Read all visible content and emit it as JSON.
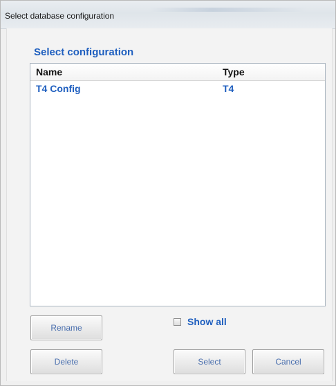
{
  "window": {
    "title": "Select database configuration"
  },
  "group": {
    "title": "Select configuration"
  },
  "list": {
    "columns": [
      "Name",
      "Type"
    ],
    "rows": [
      {
        "name": "T4 Config",
        "type": "T4"
      }
    ]
  },
  "checkbox": {
    "label": "Show all",
    "checked": false
  },
  "buttons": {
    "rename": "Rename",
    "delete": "Delete",
    "select": "Select",
    "cancel": "Cancel"
  },
  "colors": {
    "accent": "#1f5fbf"
  }
}
